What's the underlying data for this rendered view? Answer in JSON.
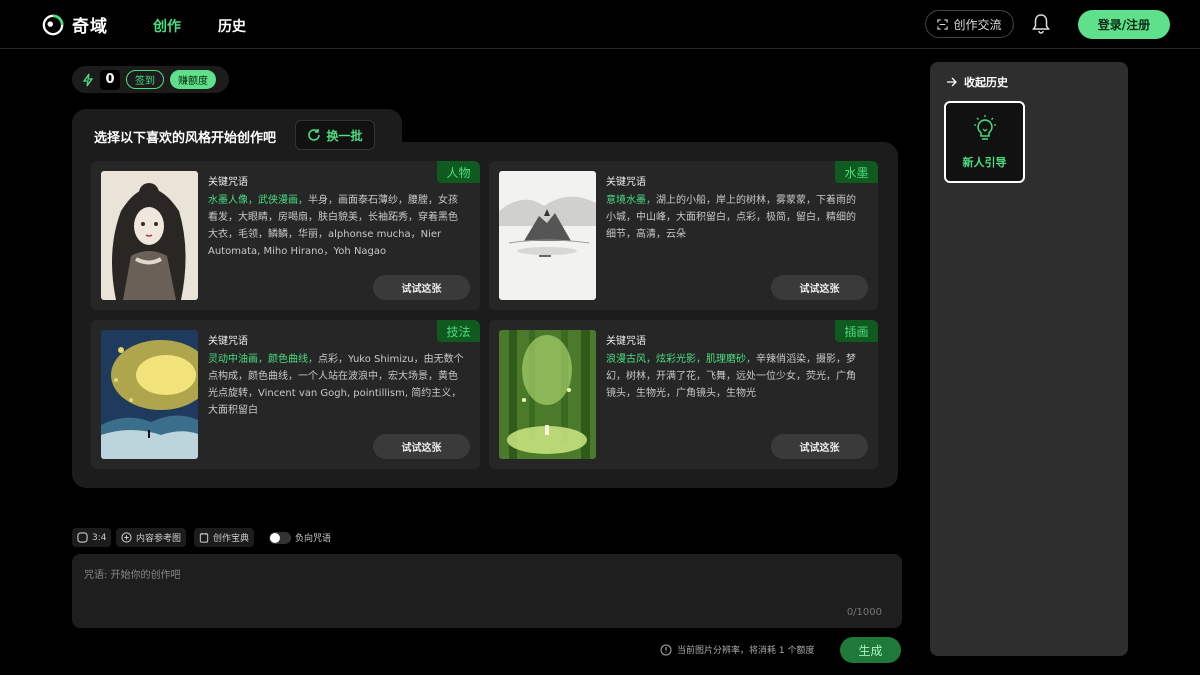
{
  "header": {
    "logo_text": "奇域",
    "nav": [
      "创作",
      "历史"
    ],
    "community_label": "创作交流",
    "login_label": "登录/注册"
  },
  "credits": {
    "count": "0",
    "checkin_label": "签到",
    "earn_label": "赚额度"
  },
  "panel": {
    "title": "选择以下喜欢的风格开始创作吧",
    "refresh_label": "换一批"
  },
  "cards": [
    {
      "tag": "人物",
      "kw_title": "关键咒语",
      "highlight": "水墨人像，武侠漫画，",
      "text": "半身，画面泰石薄纱，腰膛，女孩看发，大眼睛，房喝扇，肤白貌美，长袖跖秀，穿着黑色大衣，毛领，鳞鳞，华丽，alphonse mucha，Nier Automata, Miho Hirano，Yoh Nagao",
      "try_label": "试试这张"
    },
    {
      "tag": "水墨",
      "kw_title": "关键咒语",
      "highlight": "意境水墨，",
      "text": "湖上的小船，岸上的树林，雾蒙蒙，下着雨的小城，中山峰，大面积留白，点彩，极简，留白，精细的细节，高清，云朵",
      "try_label": "试试这张"
    },
    {
      "tag": "技法",
      "kw_title": "关键咒语",
      "highlight": "灵动中油画，颜色曲线，",
      "text": "点彩，Yuko Shimizu，由无数个点构成，颜色曲线，一个人站在波浪中，宏大场景，黄色光点旋转，Vincent van Gogh, pointillism, 简约主义，大面积留白",
      "try_label": "试试这张"
    },
    {
      "tag": "插画",
      "kw_title": "关键咒语",
      "highlight": "浪漫古风，炫彩光影，肌理磨砂，",
      "text": "辛辣俏滔染，摄影，梦幻，树林，开满了花，飞舞，远处一位少女，荧光，广角镜头，生物光，广角镜头，生物光",
      "try_label": "试试这张"
    }
  ],
  "toolbar": {
    "ratio_label": "3:4",
    "ref_label": "内容参考图",
    "treasure_label": "创作宝典",
    "negative_label": "负向咒语"
  },
  "prompt": {
    "placeholder": "咒语: 开始你的创作吧",
    "counter": "0/1000"
  },
  "notice": "当前图片分辨率，将消耗 1 个额度",
  "generate_label": "生成",
  "sidebar": {
    "collapse_label": "收起历史",
    "guide_label": "新人引导"
  },
  "colors": {
    "accent": "#4ade80",
    "button_green": "#5ee18a",
    "panel": "#1c1c1c",
    "card": "#262626"
  }
}
